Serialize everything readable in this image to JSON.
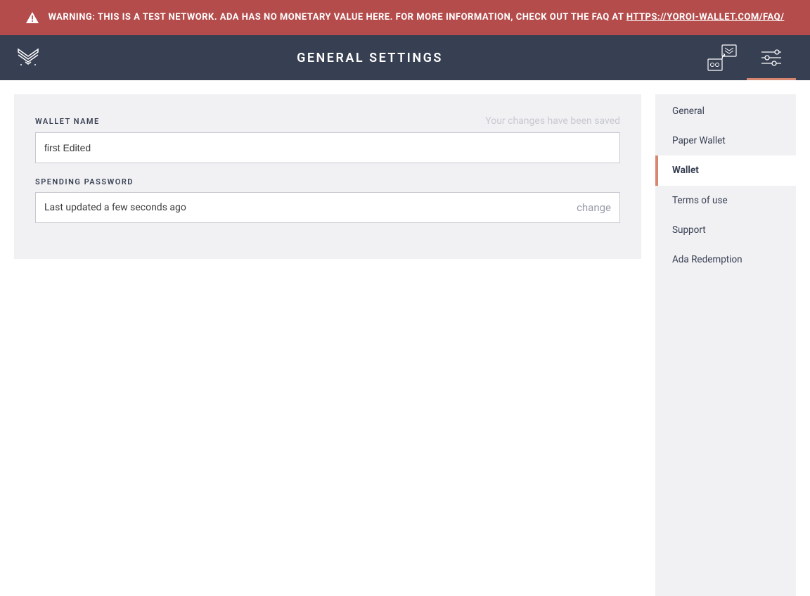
{
  "banner": {
    "text_prefix": "WARNING: THIS IS A TEST NETWORK. ADA HAS NO MONETARY VALUE HERE. FOR MORE INFORMATION, CHECK OUT THE FAQ AT ",
    "link_text": "HTTPS://YOROI-WALLET.COM/FAQ/"
  },
  "header": {
    "title": "GENERAL SETTINGS"
  },
  "main": {
    "wallet_name": {
      "label": "WALLET NAME",
      "value": "first Edited",
      "status": "Your changes have been saved"
    },
    "spending_password": {
      "label": "SPENDING PASSWORD",
      "status_text": "Last updated a few seconds ago",
      "change_label": "change"
    }
  },
  "sidebar": {
    "items": [
      {
        "label": "General",
        "active": false
      },
      {
        "label": "Paper Wallet",
        "active": false
      },
      {
        "label": "Wallet",
        "active": true
      },
      {
        "label": "Terms of use",
        "active": false
      },
      {
        "label": "Support",
        "active": false
      },
      {
        "label": "Ada Redemption",
        "active": false
      }
    ]
  }
}
